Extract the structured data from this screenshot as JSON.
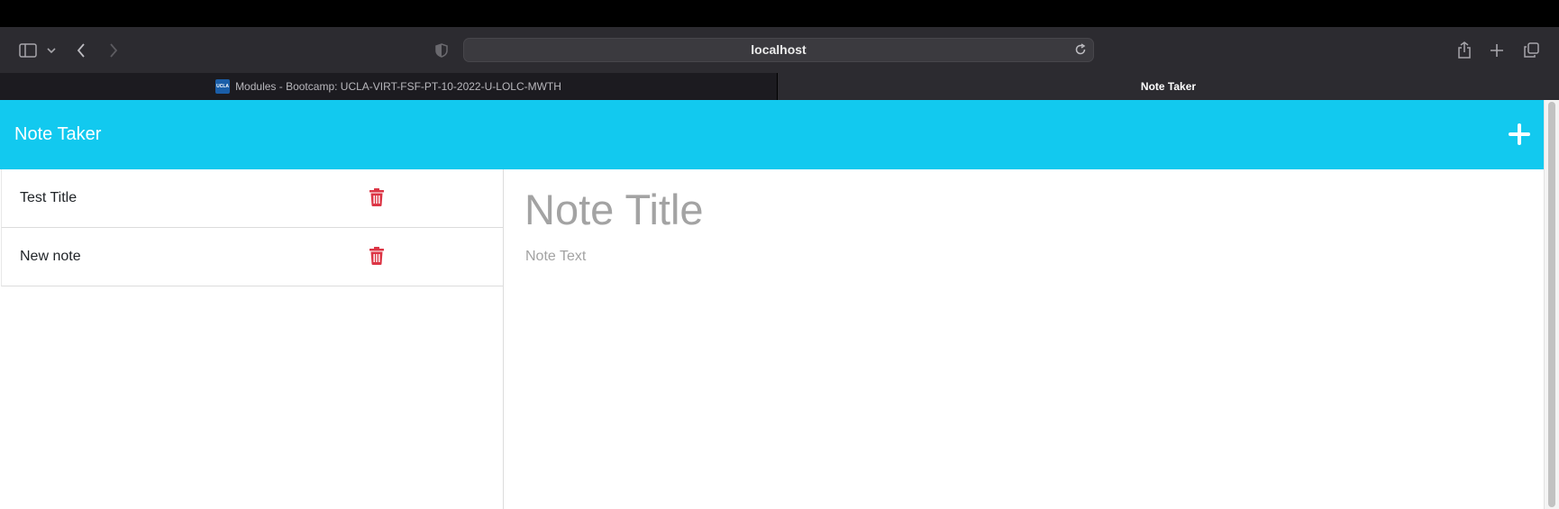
{
  "browser": {
    "url": "localhost",
    "tabs": [
      {
        "label": "Modules - Bootcamp: UCLA-VIRT-FSF-PT-10-2022-U-LOLC-MWTH",
        "favicon_text": "UCLA",
        "active": false
      },
      {
        "label": "Note Taker",
        "active": true
      }
    ]
  },
  "app": {
    "title": "Note Taker",
    "accent_color": "#12c9ef",
    "delete_color": "#dc3545"
  },
  "notes": [
    {
      "title": "Test Title"
    },
    {
      "title": "New note"
    }
  ],
  "editor": {
    "title_placeholder": "Note Title",
    "text_placeholder": "Note Text"
  }
}
